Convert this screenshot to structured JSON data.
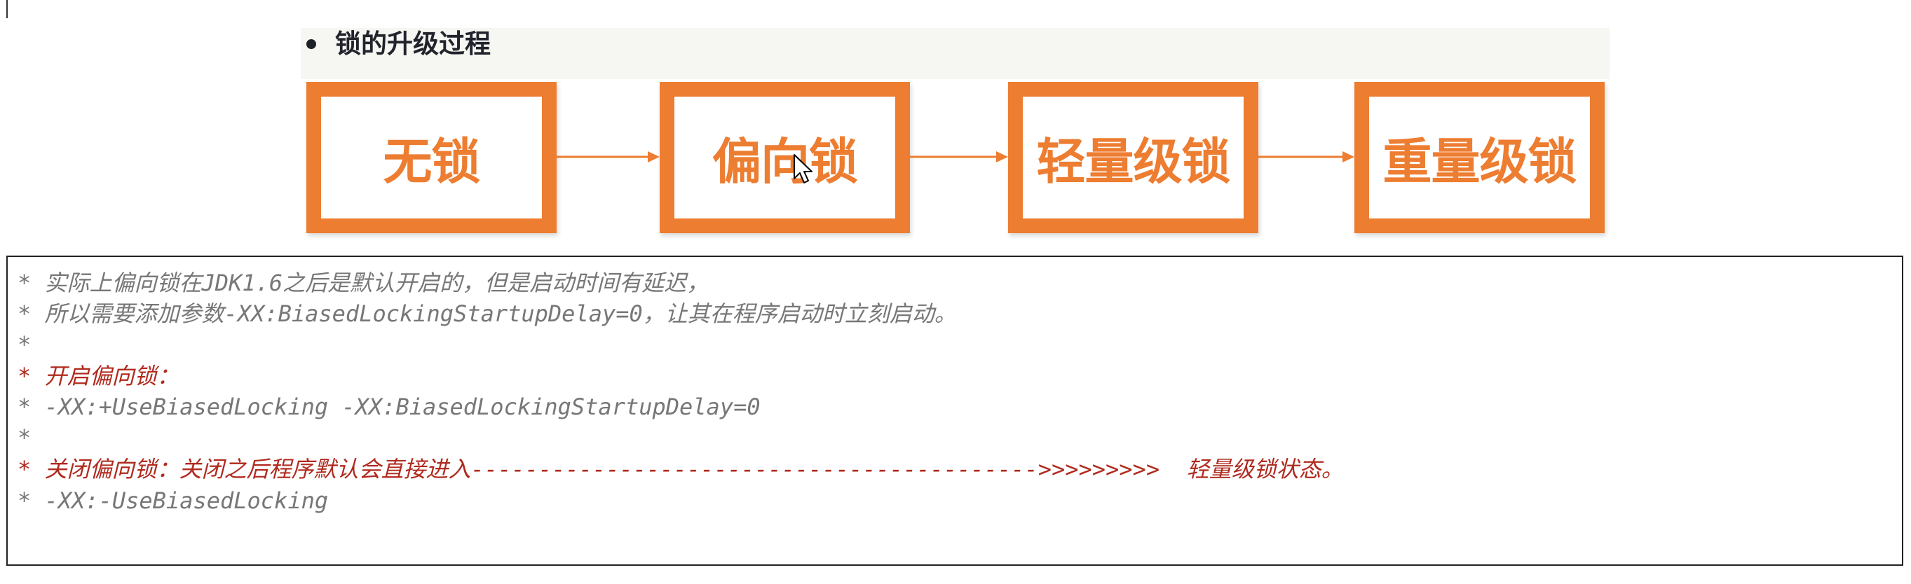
{
  "heading": "锁的升级过程",
  "stages": [
    "无锁",
    "偏向锁",
    "轻量级锁",
    "重量级锁"
  ],
  "colors": {
    "accent": "#ed7d31",
    "comment": "#777777",
    "emphasis": "#b02a1e",
    "heading_bg": "#f6f6f3"
  },
  "code_lines": [
    {
      "text": "* 实际上偏向锁在JDK1.6之后是默认开启的，但是启动时间有延迟，",
      "emphasis": false
    },
    {
      "text": "* 所以需要添加参数-XX:BiasedLockingStartupDelay=0，让其在程序启动时立刻启动。",
      "emphasis": false
    },
    {
      "text": "*",
      "emphasis": false
    },
    {
      "text": "* 开启偏向锁：",
      "emphasis": true
    },
    {
      "text": "* -XX:+UseBiasedLocking -XX:BiasedLockingStartupDelay=0",
      "emphasis": false
    },
    {
      "text": "*",
      "emphasis": false
    },
    {
      "text": "* 关闭偏向锁：关闭之后程序默认会直接进入------------------------------------------>>>>>>>>>  轻量级锁状态。",
      "emphasis": true
    },
    {
      "text": "* -XX:-UseBiasedLocking",
      "emphasis": false
    }
  ],
  "icons": {
    "bullet": "bullet-dot",
    "arrow": "right-arrow-icon",
    "pointer": "mouse-pointer-icon"
  }
}
